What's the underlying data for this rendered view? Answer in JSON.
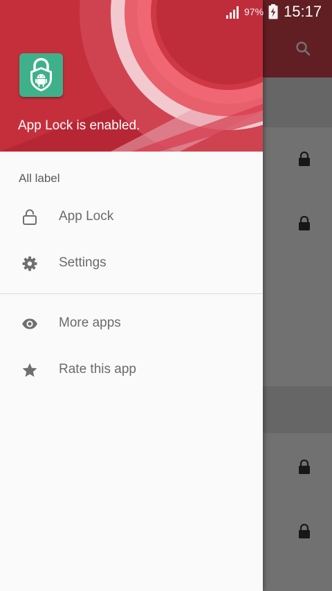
{
  "status_bar": {
    "battery_percent": "97%",
    "time": "15:17",
    "signal_icon": "signal-icon",
    "battery_icon": "battery-charging-icon"
  },
  "drawer": {
    "header": {
      "logo_icon": "app-lock-android-icon",
      "status_text": "App Lock is enabled."
    },
    "section_label": "All label",
    "items": [
      {
        "label": "App Lock",
        "icon": "unlock-icon"
      },
      {
        "label": "Settings",
        "icon": "gear-icon"
      },
      {
        "label": "More apps",
        "icon": "eye-icon"
      },
      {
        "label": "Rate this app",
        "icon": "star-icon"
      }
    ]
  },
  "background": {
    "search_icon": "search-icon",
    "lock_icon": "lock-icon"
  },
  "colors": {
    "header_red": "#c52f3c",
    "logo_green": "#3fb18a",
    "icon_gray": "#6f6f6f"
  }
}
